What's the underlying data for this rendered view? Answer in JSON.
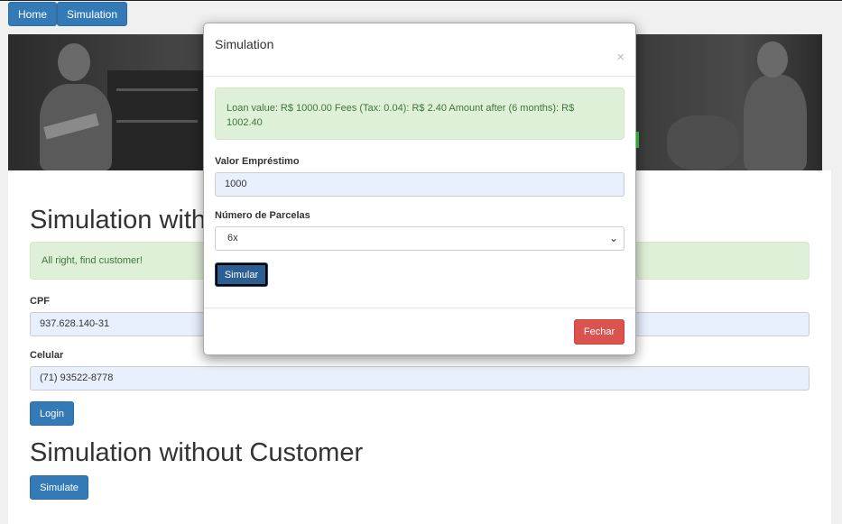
{
  "nav": {
    "home_label": "Home",
    "simulation_label": "Simulation"
  },
  "page": {
    "section1_title": "Simulation with Customer",
    "success_message": "All right, find customer!",
    "cpf_label": "CPF",
    "cpf_value": "937.628.140-31",
    "celular_label": "Celular",
    "celular_value": "(71) 93522-8778",
    "login_label": "Login",
    "section2_title": "Simulation without Customer",
    "simulate_label": "Simulate"
  },
  "modal": {
    "title": "Simulation",
    "close_glyph": "×",
    "result_message": "Loan value: R$ 1000.00 Fees (Tax: 0.04): R$ 2.40 Amount after (6 months): R$ 1002.40",
    "valor_label": "Valor Empréstimo",
    "valor_value": "1000",
    "parcelas_label": "Número de Parcelas",
    "parcelas_selected": "6x",
    "simular_label": "Simular",
    "fechar_label": "Fechar",
    "chevron_glyph": "⌄"
  },
  "colors": {
    "primary": "#337ab7",
    "danger": "#d9534f",
    "success_bg": "#dff0d8",
    "success_text": "#3c763d",
    "input_autofill": "#e8f0fe"
  }
}
